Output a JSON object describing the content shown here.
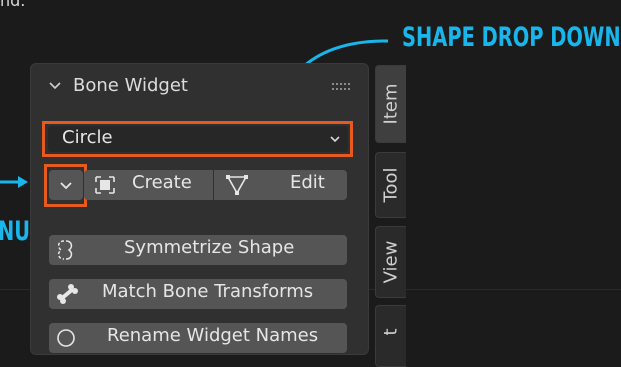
{
  "top_text": "nd.",
  "annotations": {
    "shape_dropdown": "SHAPE DROP DOWN L",
    "menu": "NU"
  },
  "colors": {
    "annotation": "#19b6ec",
    "highlight": "#e65a1e",
    "panel": "#303030",
    "button": "#555555"
  },
  "panel": {
    "title": "Bone Widget",
    "shape_dropdown": {
      "value": "Circle"
    },
    "buttons": {
      "create": "Create",
      "edit": "Edit",
      "symmetrize": "Symmetrize Shape",
      "match_transforms": "Match Bone Transforms",
      "rename_partial": "Rename Widget Names"
    },
    "icons": {
      "collapse": "chevron-down-icon",
      "grip": "grip-dots-icon",
      "menu": "chevron-down-icon",
      "create": "frame-select-icon",
      "edit": "edit-mesh-icon",
      "symmetrize": "symmetry-icon",
      "match": "bone-icon"
    }
  },
  "side_tabs": [
    "Item",
    "Tool",
    "View",
    "t"
  ]
}
